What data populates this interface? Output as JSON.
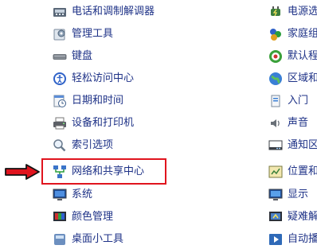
{
  "left_items": [
    {
      "label": "电话和调制解调器",
      "icon": "telephone-modem-icon"
    },
    {
      "label": "管理工具",
      "icon": "admin-tools-icon"
    },
    {
      "label": "键盘",
      "icon": "keyboard-icon"
    },
    {
      "label": "轻松访问中心",
      "icon": "ease-of-access-icon"
    },
    {
      "label": "日期和时间",
      "icon": "date-time-icon"
    },
    {
      "label": "设备和打印机",
      "icon": "printer-icon"
    },
    {
      "label": "索引选项",
      "icon": "indexing-icon"
    },
    {
      "label": "网络和共享中心",
      "icon": "network-icon"
    },
    {
      "label": "系统",
      "icon": "system-icon"
    },
    {
      "label": "颜色管理",
      "icon": "color-management-icon"
    },
    {
      "label": "桌面小工具",
      "icon": "gadgets-icon"
    }
  ],
  "right_items": [
    {
      "label": "电源选",
      "icon": "power-icon"
    },
    {
      "label": "家庭组",
      "icon": "homegroup-icon"
    },
    {
      "label": "默认程",
      "icon": "default-programs-icon"
    },
    {
      "label": "区域和",
      "icon": "region-icon"
    },
    {
      "label": "入门",
      "icon": "getting-started-icon"
    },
    {
      "label": "声音",
      "icon": "sound-icon"
    },
    {
      "label": "通知区",
      "icon": "notification-icon"
    },
    {
      "label": "位置和",
      "icon": "location-icon"
    },
    {
      "label": "显示",
      "icon": "display-icon"
    },
    {
      "label": "疑难解",
      "icon": "troubleshoot-icon"
    },
    {
      "label": "自动播",
      "icon": "autoplay-icon"
    }
  ],
  "colors": {
    "link": "#1e3287",
    "highlight": "#e0141e"
  }
}
